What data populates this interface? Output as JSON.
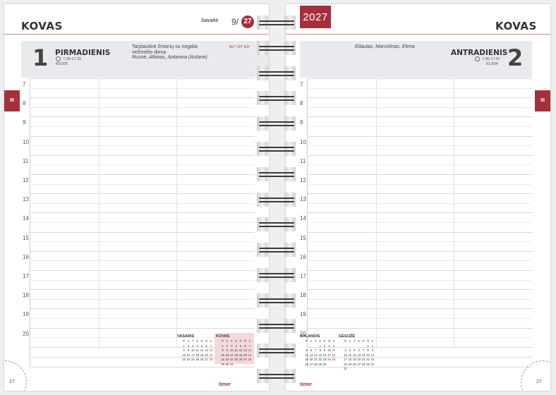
{
  "left": {
    "month": "KOVAS",
    "week_label": "Savaitė",
    "week_number": "9/",
    "week_day_badge": "27",
    "day_number": "1",
    "day_name": "PIRMADIENIS",
    "sun_times": "7.09-17.35",
    "day_of_year": "60/305",
    "holiday_note": "Tarptautinė žmonių su negalia vežimėlio diena",
    "name_days": "Rusnė, Albinas, Antanina (Antanė)",
    "moon_note": "AU° CH° ES°",
    "tab_label": "III",
    "page_number": "27",
    "brand": "timer"
  },
  "right": {
    "year": "2027",
    "month": "KOVAS",
    "name_days": "Eitautas, Marcelinas, Elena",
    "day_name": "ANTRADIENIS",
    "day_number": "2",
    "sun_times": "7.06-17.57",
    "day_of_year": "61/304",
    "tab_label": "III",
    "page_number": "27",
    "brand": "timer"
  },
  "hours": [
    "7",
    "8",
    "9",
    "10",
    "11",
    "12",
    "13",
    "14",
    "15",
    "16",
    "17",
    "18",
    "19",
    "20"
  ],
  "mini_calendars": {
    "left": [
      {
        "title": "VASARIS",
        "header": [
          "S",
          "P",
          "A",
          "T",
          "K",
          "P",
          "Š",
          "S"
        ],
        "rows": [
          [
            "",
            "1",
            "2",
            "3",
            "4",
            "5",
            "6",
            "7"
          ],
          [
            "",
            "8",
            "9",
            "10",
            "11",
            "12",
            "13",
            "14"
          ],
          [
            "",
            "15",
            "16",
            "17",
            "18",
            "19",
            "20",
            "21"
          ],
          [
            "",
            "22",
            "23",
            "24",
            "25",
            "26",
            "27",
            "28"
          ]
        ]
      },
      {
        "title": "KOVAS",
        "header": [
          "S",
          "P",
          "A",
          "T",
          "K",
          "P",
          "Š",
          "S"
        ],
        "rows": [
          [
            "",
            "1",
            "2",
            "3",
            "4",
            "5",
            "6",
            "7"
          ],
          [
            "",
            "8",
            "9",
            "10",
            "11",
            "12",
            "13",
            "14"
          ],
          [
            "",
            "15",
            "16",
            "17",
            "18",
            "19",
            "20",
            "21"
          ],
          [
            "",
            "22",
            "23",
            "24",
            "25",
            "26",
            "27",
            "28"
          ],
          [
            "",
            "29",
            "30",
            "31",
            "",
            "",
            "",
            ""
          ]
        ]
      }
    ],
    "right": [
      {
        "title": "BALANDIS",
        "header": [
          "S",
          "P",
          "A",
          "T",
          "K",
          "P",
          "Š",
          "S"
        ],
        "rows": [
          [
            "",
            "",
            "",
            "",
            "1",
            "2",
            "3",
            "4"
          ],
          [
            "",
            "5",
            "6",
            "7",
            "8",
            "9",
            "10",
            "11"
          ],
          [
            "",
            "12",
            "13",
            "14",
            "15",
            "16",
            "17",
            "18"
          ],
          [
            "",
            "19",
            "20",
            "21",
            "22",
            "23",
            "24",
            "25"
          ],
          [
            "",
            "26",
            "27",
            "28",
            "29",
            "30",
            "",
            ""
          ]
        ]
      },
      {
        "title": "GEGUŽĖ",
        "header": [
          "S",
          "P",
          "A",
          "T",
          "K",
          "P",
          "Š",
          "S"
        ],
        "rows": [
          [
            "",
            "",
            "",
            "",
            "",
            "",
            "1",
            "2"
          ],
          [
            "",
            "3",
            "4",
            "5",
            "6",
            "7",
            "8",
            "9"
          ],
          [
            "",
            "10",
            "11",
            "12",
            "13",
            "14",
            "15",
            "16"
          ],
          [
            "",
            "17",
            "18",
            "19",
            "20",
            "21",
            "22",
            "23"
          ],
          [
            "",
            "24",
            "25",
            "26",
            "27",
            "28",
            "29",
            "30"
          ],
          [
            "",
            "31",
            "",
            "",
            "",
            "",
            "",
            ""
          ]
        ]
      }
    ]
  },
  "colors": {
    "accent": "#a5303b",
    "band": "#e9eaed",
    "text": "#444444"
  }
}
